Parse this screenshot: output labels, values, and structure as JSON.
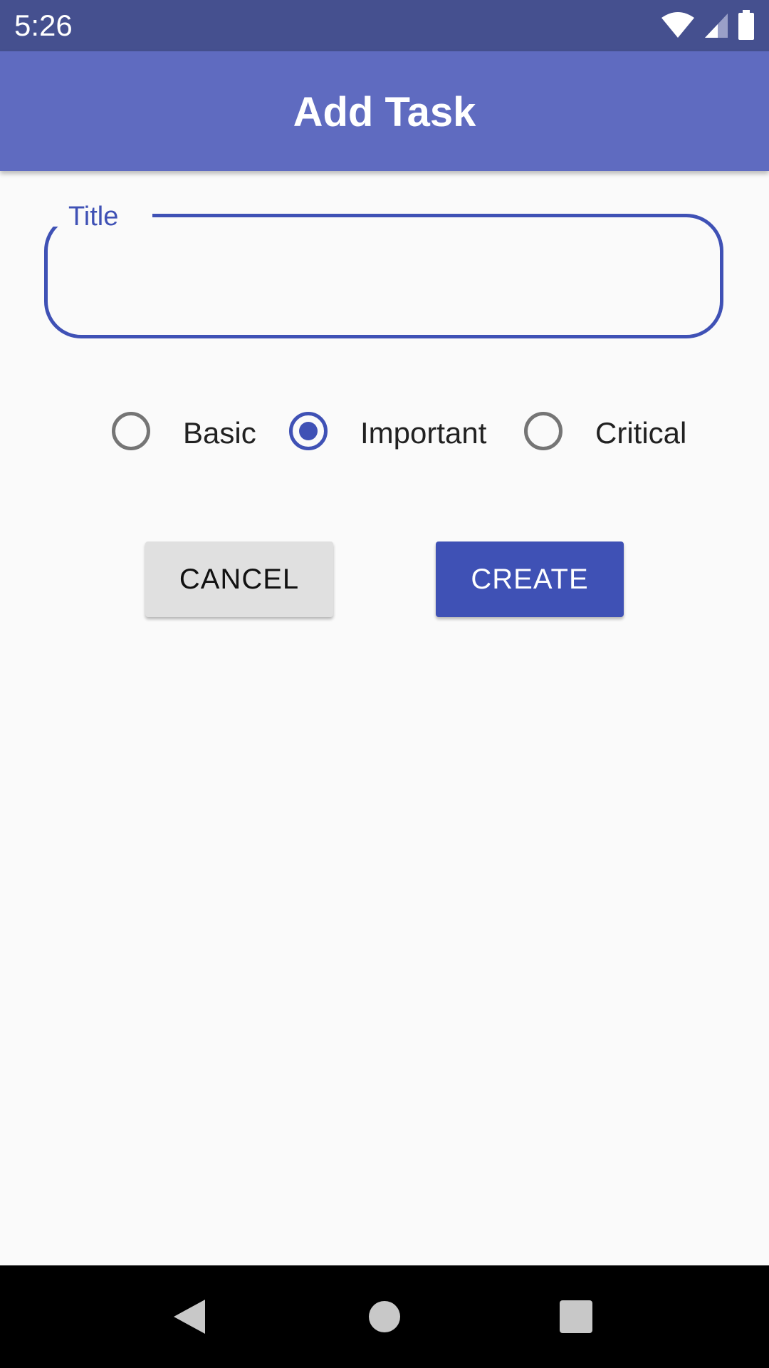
{
  "status_bar": {
    "time": "5:26",
    "icons": [
      "wifi-icon",
      "cell-signal-icon",
      "battery-icon"
    ]
  },
  "app_bar": {
    "title": "Add Task",
    "color": "#5f6bc0"
  },
  "form": {
    "title_field": {
      "label": "Title",
      "value": ""
    },
    "priority": {
      "options": [
        "Basic",
        "Important",
        "Critical"
      ],
      "selected": "Important"
    }
  },
  "actions": {
    "cancel_label": "CANCEL",
    "create_label": "CREATE"
  },
  "colors": {
    "accent": "#3f51b5",
    "status_bar": "#45508f"
  }
}
